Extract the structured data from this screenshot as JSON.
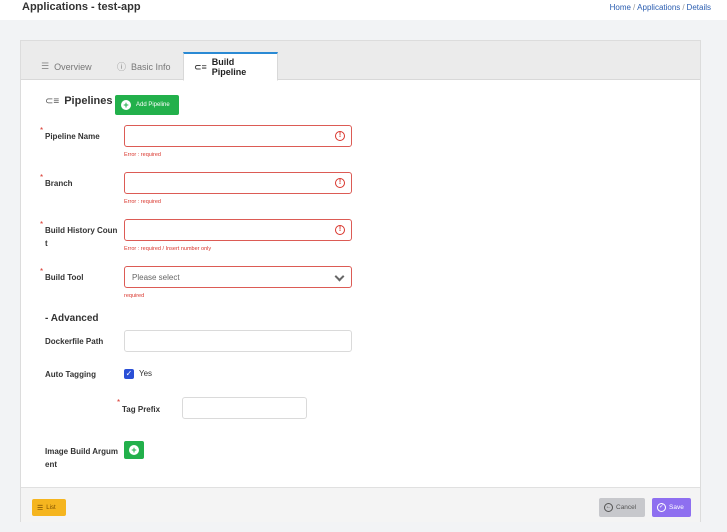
{
  "header": {
    "title": "Applications - test-app",
    "breadcrumb": [
      "Home",
      "Applications",
      "Details"
    ]
  },
  "tabs": [
    {
      "label": "Overview",
      "icon": "list-icon"
    },
    {
      "label": "Basic Info",
      "icon": "info-icon"
    },
    {
      "label": "Build Pipeline",
      "icon": "pipeline-icon",
      "active": true
    }
  ],
  "pipelines": {
    "title": "Pipelines",
    "add_label": "Add Pipeline"
  },
  "form": {
    "pipeline_name": {
      "label": "Pipeline Name",
      "value": "",
      "error": "Error : required"
    },
    "branch": {
      "label": "Branch",
      "value": "",
      "error": "Error : required"
    },
    "build_history_count": {
      "label_line1": "Build History Coun",
      "label_line2": "t",
      "value": "",
      "error": "Error : required / Insert number only"
    },
    "build_tool": {
      "label": "Build Tool",
      "placeholder": "Please select",
      "error": "required"
    }
  },
  "advanced": {
    "title": "- Advanced",
    "dockerfile_path": {
      "label": "Dockerfile Path",
      "value": ""
    },
    "auto_tagging": {
      "label": "Auto Tagging",
      "checked": true,
      "option": "Yes"
    },
    "tag_prefix": {
      "label": "Tag Prefix",
      "value": ""
    },
    "image_build_argument": {
      "label_line1": "Image Build Argum",
      "label_line2": "ent"
    }
  },
  "footer": {
    "list_label": "List",
    "cancel_label": "Cancel",
    "save_label": "Save"
  },
  "colors": {
    "accent_green": "#22b04b",
    "error_red": "#d9342b",
    "save_purple": "#8e6ff0",
    "list_yellow": "#f5b51f",
    "tab_active_border": "#2a8ad4"
  }
}
